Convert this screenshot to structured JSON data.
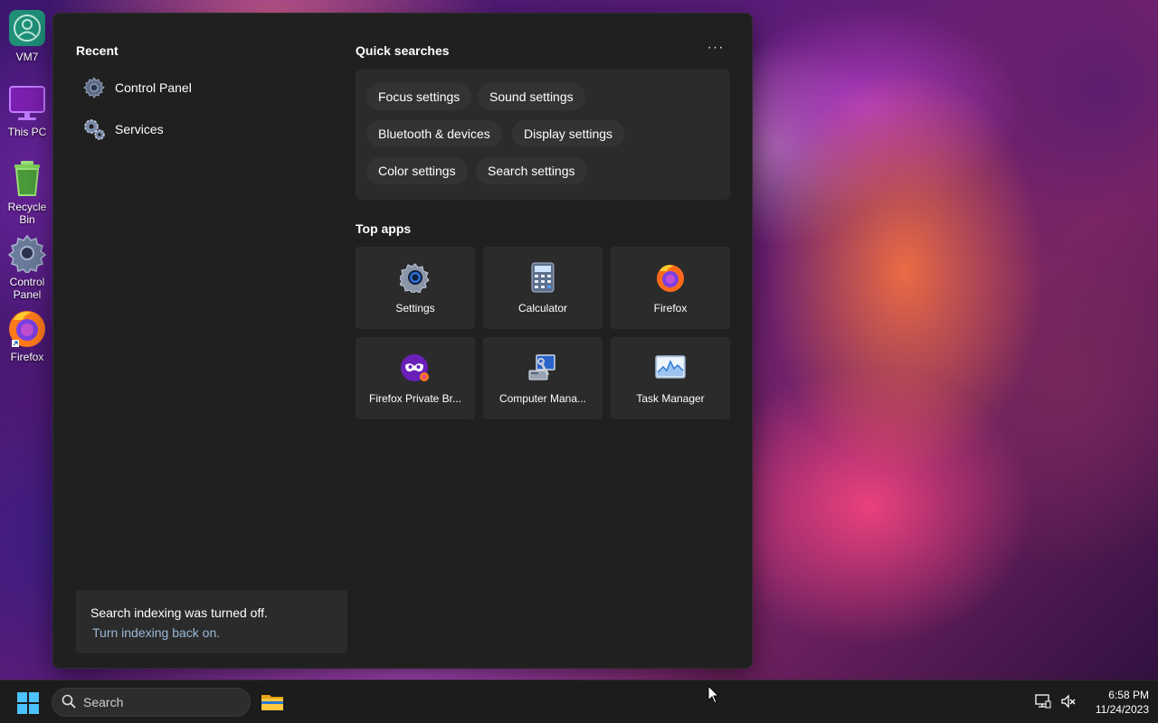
{
  "desktop": {
    "icons": [
      {
        "label": "VM7",
        "icon": "vm-user-icon"
      },
      {
        "label": "This PC",
        "icon": "monitor-icon"
      },
      {
        "label": "Recycle Bin",
        "icon": "recycle-bin-icon"
      },
      {
        "label": "Control Panel",
        "icon": "gear-icon"
      },
      {
        "label": "Firefox",
        "icon": "firefox-icon"
      }
    ]
  },
  "panel": {
    "recent": {
      "title": "Recent",
      "items": [
        {
          "label": "Control Panel",
          "icon": "control-panel-gear-icon"
        },
        {
          "label": "Services",
          "icon": "services-gears-icon"
        }
      ]
    },
    "quick_searches": {
      "title": "Quick searches",
      "more_label": "···",
      "chips": [
        "Focus settings",
        "Sound settings",
        "Bluetooth & devices",
        "Display settings",
        "Color settings",
        "Search settings"
      ]
    },
    "top_apps": {
      "title": "Top apps",
      "apps": [
        {
          "label": "Settings",
          "icon": "settings-gear-icon"
        },
        {
          "label": "Calculator",
          "icon": "calculator-icon"
        },
        {
          "label": "Firefox",
          "icon": "firefox-icon"
        },
        {
          "label": "Firefox Private Br...",
          "icon": "firefox-private-icon"
        },
        {
          "label": "Computer Mana...",
          "icon": "computer-management-icon"
        },
        {
          "label": "Task Manager",
          "icon": "task-manager-icon"
        }
      ]
    },
    "notice": {
      "text": "Search indexing was turned off.",
      "link": "Turn indexing back on."
    }
  },
  "taskbar": {
    "search_placeholder": "Search",
    "time": "6:58 PM",
    "date": "11/24/2023"
  },
  "colors": {
    "panel_bg": "#202020",
    "chip_bg": "#333333",
    "link": "#9bb8d6",
    "accent": "#0078d4"
  }
}
